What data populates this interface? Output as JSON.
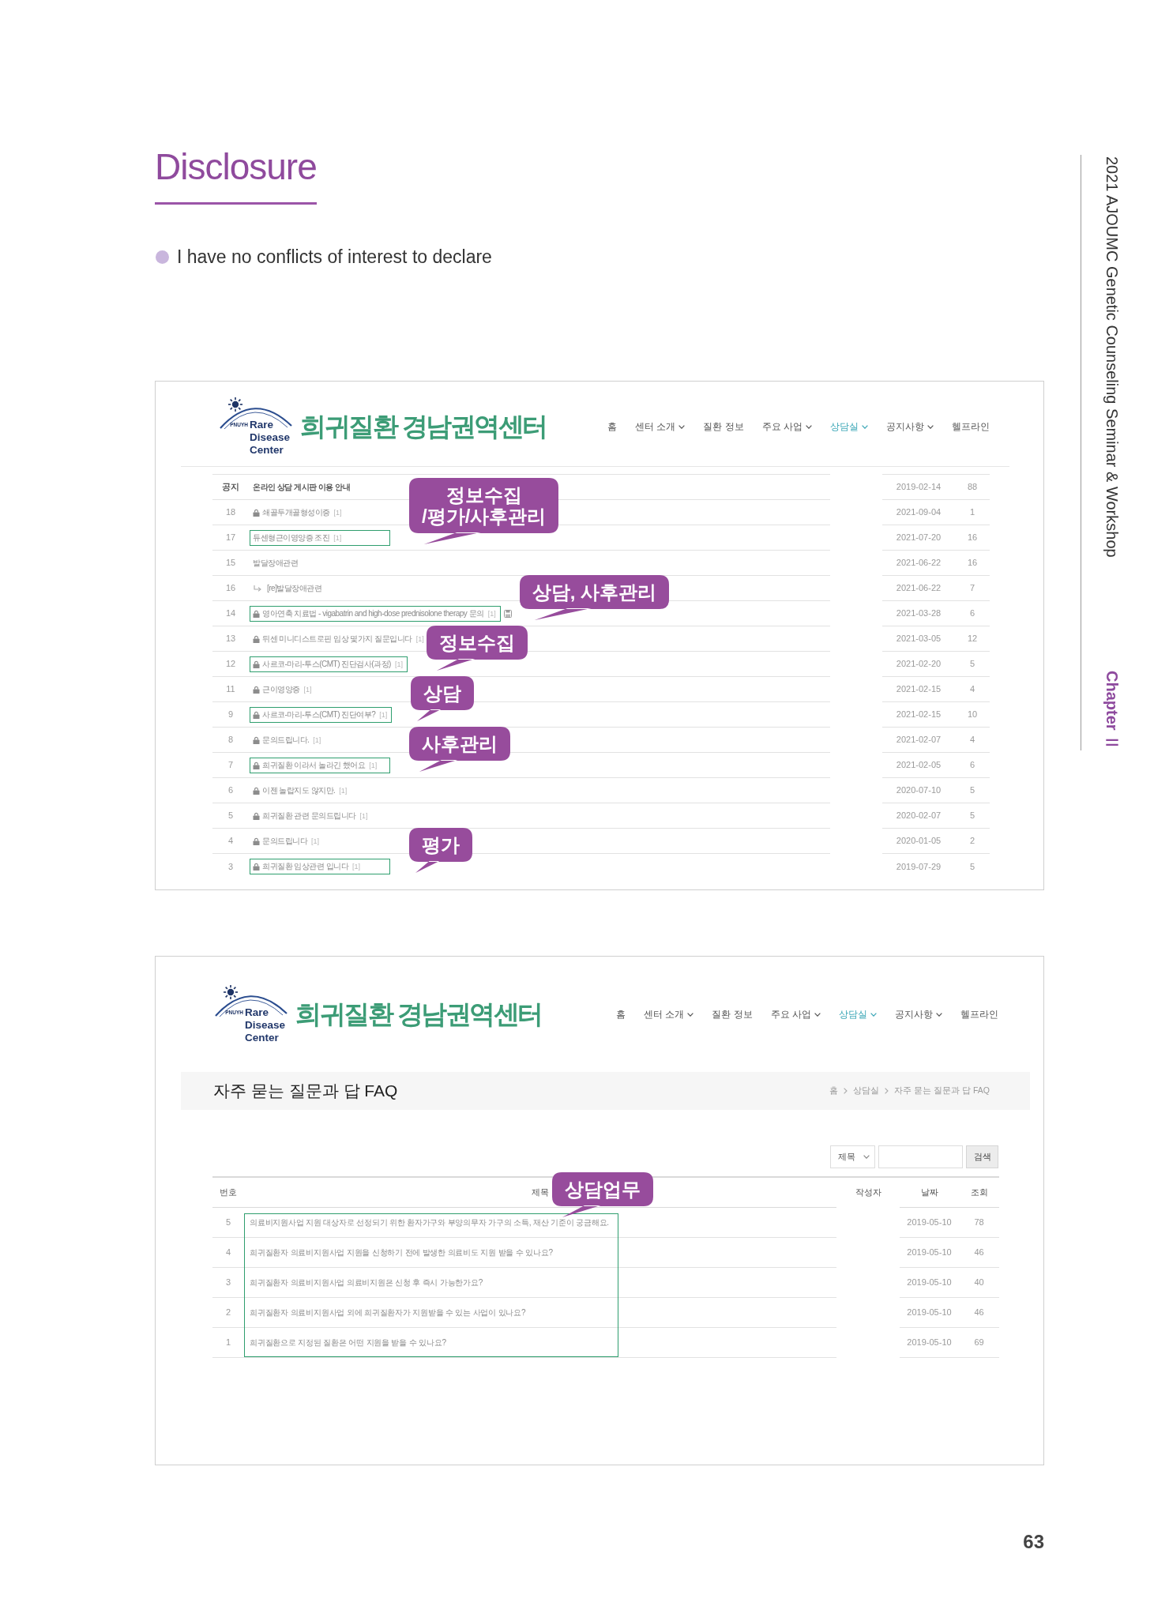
{
  "slide": {
    "title": "Disclosure",
    "bullets": [
      "I have no conflicts of interest to declare"
    ]
  },
  "screenshots": [
    {
      "kind": "board",
      "logo": {
        "org": "PNUYH",
        "lines": [
          "Rare",
          "Disease",
          "Center"
        ],
        "site_name": "희귀질환 경남권역센터"
      },
      "nav": [
        {
          "label": "홈",
          "dropdown": false,
          "selected": false
        },
        {
          "label": "센터 소개",
          "dropdown": true,
          "selected": false
        },
        {
          "label": "질환 정보",
          "dropdown": false,
          "selected": false
        },
        {
          "label": "주요 사업",
          "dropdown": true,
          "selected": false
        },
        {
          "label": "상담실",
          "dropdown": true,
          "selected": true
        },
        {
          "label": "공지사항",
          "dropdown": true,
          "selected": false
        },
        {
          "label": "헬프라인",
          "dropdown": false,
          "selected": false
        }
      ],
      "rows": [
        {
          "kind": "notice",
          "num": "공지",
          "title": "온라인 상담 게시판 이용 안내",
          "secret": false,
          "attachment": false,
          "boxed": false,
          "date": "2019-02-14",
          "views": "88"
        },
        {
          "kind": "post",
          "num": "18",
          "title": "쇄골두개골형성이증",
          "comments": "[1]",
          "secret": true,
          "attachment": false,
          "boxed": false,
          "date": "2021-09-04",
          "views": "1"
        },
        {
          "kind": "post",
          "num": "17",
          "title": "듀센형근이영양증 조진",
          "comments": "[1]",
          "secret": false,
          "attachment": false,
          "boxed": true,
          "callout": "정보수집\n/평가/사후관리",
          "date": "2021-07-20",
          "views": "16"
        },
        {
          "kind": "post",
          "num": "15",
          "title": "발달장애관련",
          "secret": false,
          "attachment": false,
          "boxed": false,
          "date": "2021-06-22",
          "views": "16"
        },
        {
          "kind": "reply",
          "num": "16",
          "title": "[re]발달장애관련",
          "secret": false,
          "attachment": false,
          "boxed": false,
          "date": "2021-06-22",
          "views": "7"
        },
        {
          "kind": "post",
          "num": "14",
          "title": "영아연축 치료법 - vigabatrin and high-dose prednisolone therapy 문의",
          "comments": "[1]",
          "secret": true,
          "attachment": true,
          "boxed": true,
          "callout": "상담, 사후관리",
          "date": "2021-03-28",
          "views": "6"
        },
        {
          "kind": "post",
          "num": "13",
          "title": "뒤센 미니디스트로핀 임상 몇가지 질문입니다",
          "comments": "[1]",
          "secret": true,
          "attachment": false,
          "boxed": false,
          "date": "2021-03-05",
          "views": "12"
        },
        {
          "kind": "post",
          "num": "12",
          "title": "사르코-마리-투스(CMT) 진단검사(과정)",
          "comments": "[1]",
          "secret": true,
          "attachment": false,
          "boxed": true,
          "callout": "정보수집",
          "date": "2021-02-20",
          "views": "5"
        },
        {
          "kind": "post",
          "num": "11",
          "title": "근이영양증",
          "comments": "[1]",
          "secret": true,
          "attachment": false,
          "boxed": false,
          "date": "2021-02-15",
          "views": "4"
        },
        {
          "kind": "post",
          "num": "9",
          "title": "사르코-마리-투스(CMT) 진단여부?",
          "comments": "[1]",
          "secret": true,
          "attachment": false,
          "boxed": true,
          "callout": "상담",
          "date": "2021-02-15",
          "views": "10"
        },
        {
          "kind": "post",
          "num": "8",
          "title": "문의드립니다.",
          "comments": "[1]",
          "secret": true,
          "attachment": false,
          "boxed": false,
          "date": "2021-02-07",
          "views": "4"
        },
        {
          "kind": "post",
          "num": "7",
          "title": "희귀질환 이라서 놀라긴 했어요",
          "comments": "[1]",
          "secret": true,
          "attachment": false,
          "boxed": true,
          "callout": "사후관리",
          "date": "2021-02-05",
          "views": "6"
        },
        {
          "kind": "post",
          "num": "6",
          "title": "이젠 놀랍지도 않지만.",
          "comments": "[1]",
          "secret": true,
          "attachment": false,
          "boxed": false,
          "date": "2020-07-10",
          "views": "5"
        },
        {
          "kind": "post",
          "num": "5",
          "title": "희귀질환 관련 문의드립니다",
          "comments": "[1]",
          "secret": true,
          "attachment": false,
          "boxed": false,
          "date": "2020-02-07",
          "views": "5"
        },
        {
          "kind": "post",
          "num": "4",
          "title": "문의드립니다",
          "comments": "[1]",
          "secret": true,
          "attachment": false,
          "boxed": false,
          "date": "2020-01-05",
          "views": "2"
        },
        {
          "kind": "post",
          "num": "3",
          "title": "희귀질환 임상관련 입니다",
          "comments": "[1]",
          "secret": true,
          "attachment": false,
          "boxed": true,
          "callout": "평가",
          "date": "2019-07-29",
          "views": "5"
        }
      ]
    },
    {
      "kind": "faq",
      "logo": {
        "org": "PNUYH",
        "lines": [
          "Rare",
          "Disease",
          "Center"
        ],
        "site_name": "희귀질환 경남권역센터"
      },
      "nav": [
        {
          "label": "홈",
          "dropdown": false,
          "selected": false
        },
        {
          "label": "센터 소개",
          "dropdown": true,
          "selected": false
        },
        {
          "label": "질환 정보",
          "dropdown": false,
          "selected": false
        },
        {
          "label": "주요 사업",
          "dropdown": true,
          "selected": false
        },
        {
          "label": "상담실",
          "dropdown": true,
          "selected": true
        },
        {
          "label": "공지사항",
          "dropdown": true,
          "selected": false
        },
        {
          "label": "헬프라인",
          "dropdown": false,
          "selected": false
        }
      ],
      "page_title": "자주 묻는 질문과 답 FAQ",
      "breadcrumb": [
        "홈",
        "상담실",
        "자주 묻는 질문과 답 FAQ"
      ],
      "search": {
        "select": "제목",
        "button": "검색"
      },
      "columns": [
        "번호",
        "제목",
        "작성자",
        "날짜",
        "조회"
      ],
      "rows": [
        {
          "num": "5",
          "title": "의료비지원사업 지원 대상자로 선정되기 위한 환자가구와 부양의무자 가구의 소득, 재산 기준이 궁금해요.",
          "date": "2019-05-10",
          "views": "78"
        },
        {
          "num": "4",
          "title": "희귀질환자 의료비지원사업 지원을 신청하기 전에 발생한 의료비도 지원 받을 수 있나요?",
          "date": "2019-05-10",
          "views": "46"
        },
        {
          "num": "3",
          "title": "희귀질환자 의료비지원사업 의료비지원은 신청 후 즉시 가능한가요?",
          "date": "2019-05-10",
          "views": "40"
        },
        {
          "num": "2",
          "title": "희귀질환자 의료비지원사업 외에 희귀질환자가 지원받을 수 있는 사업이 있나요?",
          "date": "2019-05-10",
          "views": "46"
        },
        {
          "num": "1",
          "title": "희귀질환으로 지정된 질환은 어떤 지원을 받을 수 있나요?",
          "date": "2019-05-10",
          "views": "69"
        }
      ],
      "annotation": {
        "callout": "상담업무"
      }
    }
  ],
  "side_banner": {
    "title": "2021 AJOUMC Genetic Counseling Seminar & Workshop",
    "chapter": "Chapter Ⅱ"
  },
  "page_number": "63"
}
